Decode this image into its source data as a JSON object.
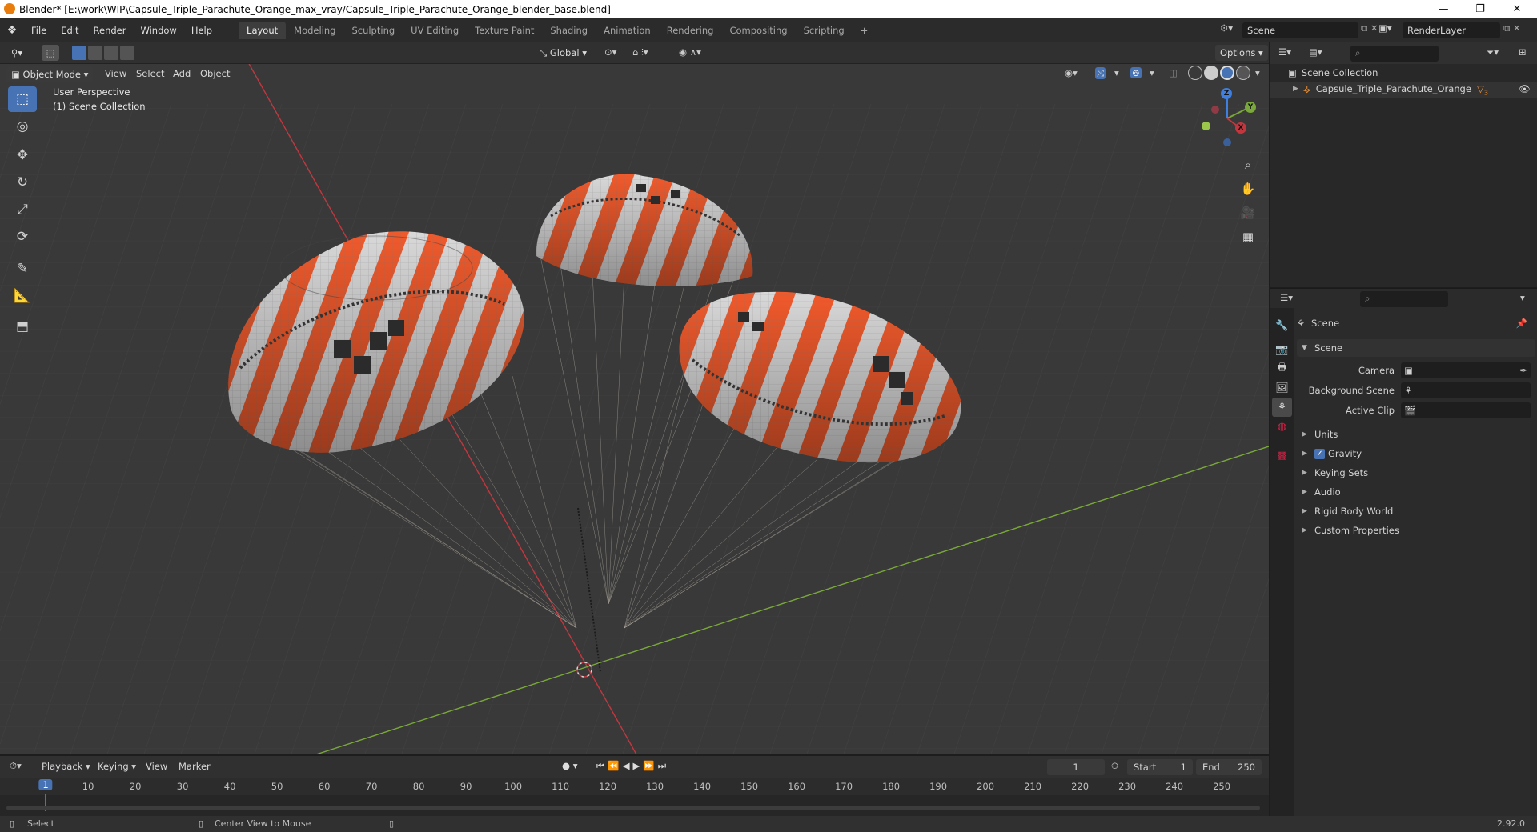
{
  "title": "Blender* [E:\\work\\WIP\\Capsule_Triple_Parachute_Orange_max_vray/Capsule_Triple_Parachute_Orange_blender_base.blend]",
  "window_controls": [
    "—",
    "❐",
    "✕"
  ],
  "menu": [
    "File",
    "Edit",
    "Render",
    "Window",
    "Help"
  ],
  "workspaces": [
    "Layout",
    "Modeling",
    "Sculpting",
    "UV Editing",
    "Texture Paint",
    "Shading",
    "Animation",
    "Rendering",
    "Compositing",
    "Scripting"
  ],
  "add_workspace": "+",
  "scene_name": "Scene",
  "render_layer": "RenderLayer",
  "viewport": {
    "mode": "Object Mode",
    "menus": [
      "View",
      "Select",
      "Add",
      "Object"
    ],
    "transform_orientation": "Global",
    "options": "Options",
    "overlay_line1": "User Perspective",
    "overlay_line2": "(1) Scene Collection",
    "gizmo_axes": [
      "Z",
      "Y",
      "X"
    ]
  },
  "outliner": {
    "collection": "Scene Collection",
    "object": "Capsule_Triple_Parachute_Orange",
    "modifier_count": "3"
  },
  "properties": {
    "context": "Scene",
    "panel_title": "Scene",
    "camera_label": "Camera",
    "background_scene_label": "Background Scene",
    "active_clip_label": "Active Clip",
    "sections": [
      "Units",
      "Gravity",
      "Keying Sets",
      "Audio",
      "Rigid Body World",
      "Custom Properties"
    ],
    "gravity_checked": true
  },
  "timeline": {
    "menus": [
      "Playback",
      "Keying",
      "View",
      "Marker"
    ],
    "current_frame": "1",
    "start_label": "Start",
    "start": "1",
    "end_label": "End",
    "end": "250",
    "ruler": [
      "1",
      "10",
      "20",
      "30",
      "40",
      "50",
      "60",
      "70",
      "80",
      "90",
      "100",
      "110",
      "120",
      "130",
      "140",
      "150",
      "160",
      "170",
      "180",
      "190",
      "200",
      "210",
      "220",
      "230",
      "240",
      "250"
    ]
  },
  "status": {
    "left": "Select",
    "middle": "Center View to Mouse",
    "version": "2.92.0"
  },
  "colors": {
    "accent": "#4772b3",
    "chute_orange": "#f05a2c",
    "x_axis": "#c2373f",
    "y_axis": "#7aa83a",
    "z_axis": "#3f7fe0"
  }
}
